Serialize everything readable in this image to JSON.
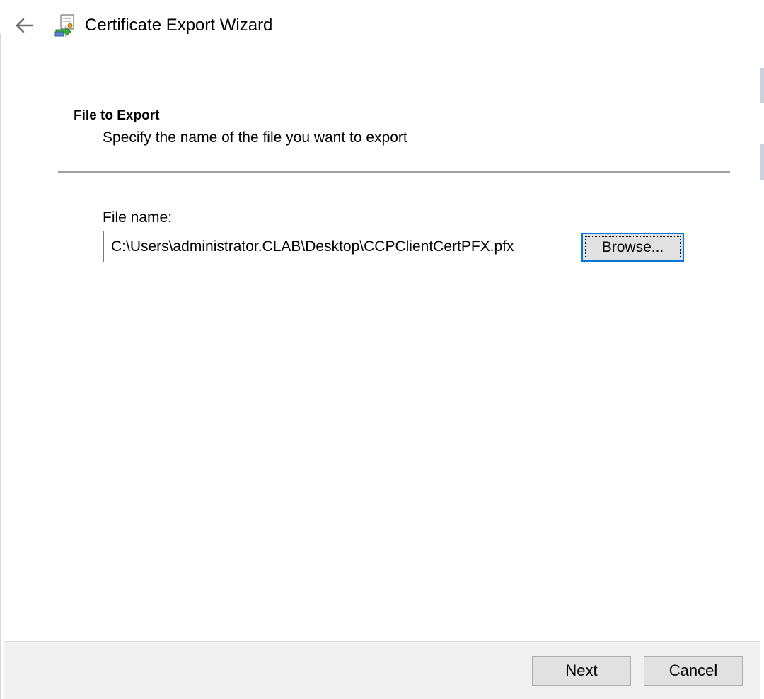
{
  "window": {
    "title": "Certificate Export Wizard"
  },
  "icons": {
    "back": "back-arrow-icon",
    "wizard": "certificate-wizard-icon"
  },
  "colors": {
    "accent": "#0078d7",
    "footer_bg": "#f0f0f0",
    "button_bg": "#e1e1e1"
  },
  "page": {
    "heading": "File to Export",
    "subheading": "Specify the name of the file you want to export"
  },
  "form": {
    "file_label": "File name:",
    "file_value": "C:\\Users\\administrator.CLAB\\Desktop\\CCPClientCertPFX.pfx",
    "browse_label": "Browse..."
  },
  "footer": {
    "next_label": "Next",
    "cancel_label": "Cancel"
  }
}
